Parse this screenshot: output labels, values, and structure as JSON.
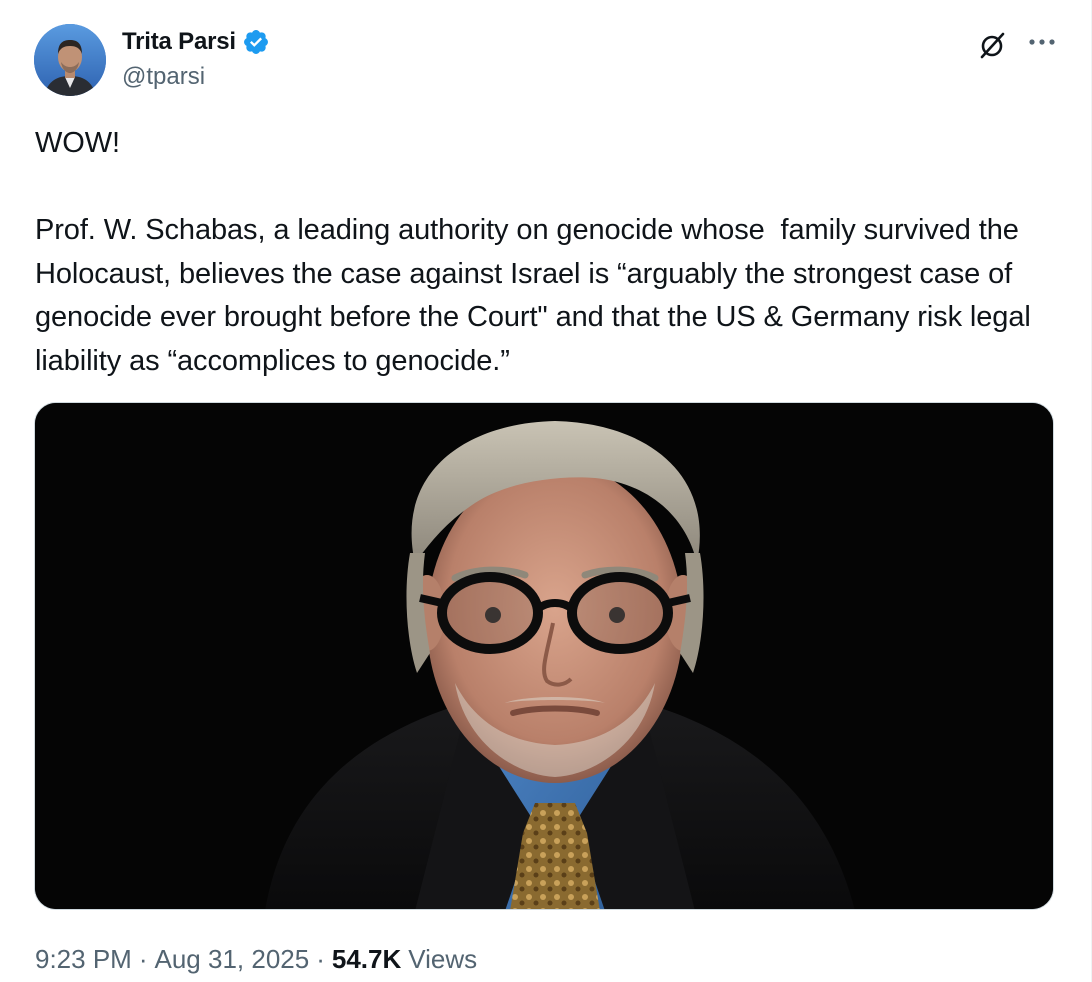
{
  "author": {
    "display_name": "Trita Parsi",
    "handle": "@tparsi",
    "verified": true,
    "avatar_icon": "profile-photo"
  },
  "actions": {
    "grok_icon": "grok-icon",
    "more_icon": "more-horizontal-icon",
    "more_label": "···"
  },
  "tweet": {
    "text": "WOW!\n\nProf. W. Schabas, a leading authority on genocide whose  family survived the Holocaust, believes the case against Israel is “arguably the strongest case of genocide ever brought before the Court\" and that the US & Germany risk legal liability as “accomplices to genocide.”"
  },
  "media": {
    "type": "photo",
    "description_icon": "photo-of-man-with-glasses"
  },
  "meta": {
    "time": "9:23 PM",
    "date": "Aug 31, 2025",
    "views_count": "54.7K",
    "views_label": "Views",
    "separator": "·"
  },
  "colors": {
    "verified_blue": "#1d9bf0",
    "text_primary": "#0f1419",
    "text_secondary": "#536471"
  }
}
